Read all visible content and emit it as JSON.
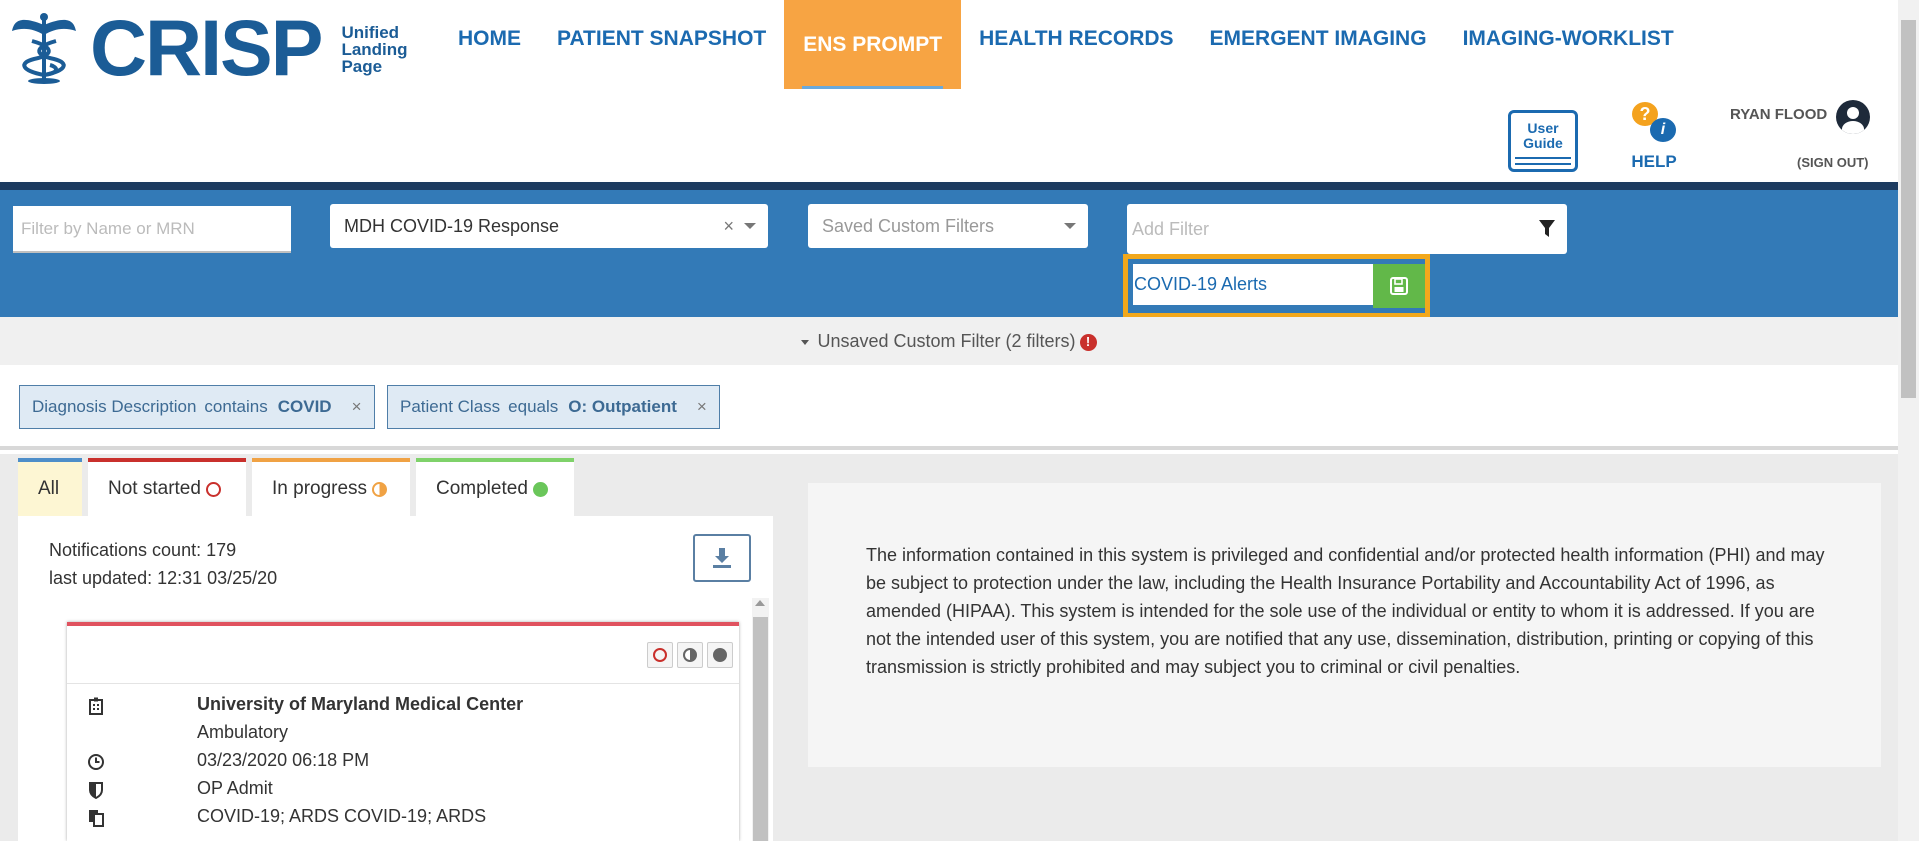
{
  "brand": {
    "word": "CRISP",
    "subtitle_line1": "Unified",
    "subtitle_line2": "Landing",
    "subtitle_line3": "Page"
  },
  "nav": {
    "items": [
      {
        "label": "HOME"
      },
      {
        "label": "PATIENT SNAPSHOT"
      },
      {
        "label": "ENS PROMPT"
      },
      {
        "label": "HEALTH RECORDS"
      },
      {
        "label": "EMERGENT IMAGING"
      },
      {
        "label": "IMAGING-WORKLIST"
      }
    ],
    "active": "ENS PROMPT"
  },
  "header_right": {
    "user_guide_line1": "User",
    "user_guide_line2": "Guide",
    "help_label": "HELP",
    "user_name": "RYAN FLOOD",
    "sign_out": "(SIGN OUT)"
  },
  "filters": {
    "name_placeholder": "Filter by Name or MRN",
    "response_select": "MDH COVID-19 Response",
    "clear_symbol": "×",
    "saved_filters_placeholder": "Saved Custom Filters",
    "add_filter_placeholder": "Add Filter",
    "save_name_value": "COVID-19 Alerts"
  },
  "unsaved": {
    "label": "Unsaved Custom Filter (2 filters)",
    "warning_symbol": "!"
  },
  "chips": [
    {
      "field": "Diagnosis Description",
      "op": "contains",
      "value": "COVID",
      "remove": "×"
    },
    {
      "field": "Patient Class",
      "op": "equals",
      "value": "O: Outpatient",
      "remove": "×"
    }
  ],
  "tabs": [
    {
      "label": "All"
    },
    {
      "label": "Not started"
    },
    {
      "label": "In progress"
    },
    {
      "label": "Completed"
    }
  ],
  "notifications": {
    "count_text": "Notifications count: 179",
    "updated_text": "last updated: 12:31 03/25/20"
  },
  "card": {
    "facility": "University of Maryland Medical Center",
    "type": "Ambulatory",
    "datetime": "03/23/2020 06:18 PM",
    "event": "OP Admit",
    "diagnosis": "COVID-19; ARDS COVID-19; ARDS"
  },
  "disclaimer": "The information contained in this system is privileged and confidential and/or protected health information (PHI) and may be subject to protection under the law, including the Health Insurance Portability and Accountability Act of 1996, as amended (HIPAA). This system is intended for the sole use of the individual or entity to whom it is addressed. If you are not the intended user of this system, you are notified that any use, dissemination, distribution, printing or copying of this transmission is strictly prohibited and may subject you to criminal or civil penalties.",
  "colors": {
    "brand_blue": "#1b5c96",
    "nav_active": "#f7a443",
    "filter_band": "#337ab7",
    "save_green": "#62b849",
    "highlight_border": "#f2a81c"
  },
  "icons": {
    "logo": "caduceus-emblem-icon",
    "funnel": "filter-funnel-icon",
    "save": "floppy-disk-icon",
    "download": "download-icon",
    "facility": "hospital-icon",
    "time": "clock-icon",
    "event": "shield-icon",
    "diagnosis": "documents-icon"
  }
}
